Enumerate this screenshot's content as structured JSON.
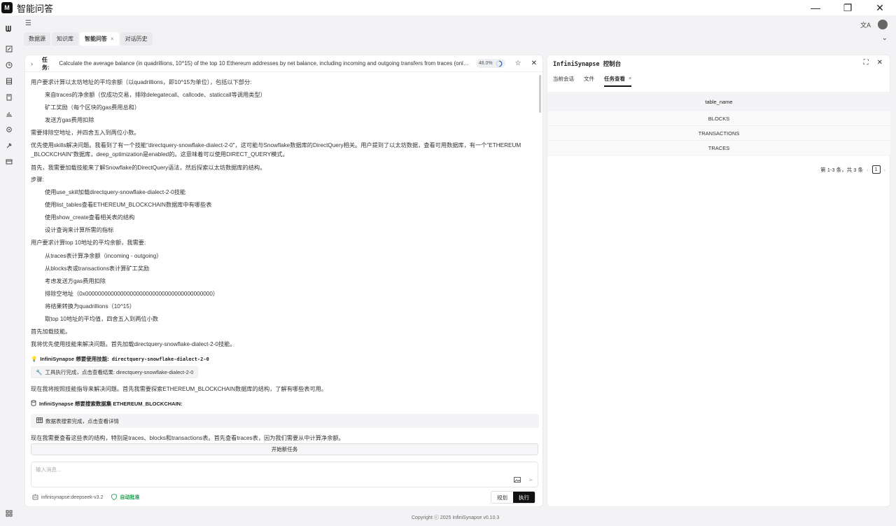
{
  "app": {
    "title": "智能问答",
    "logo_text": "M"
  },
  "window_controls": {
    "minimize": "—",
    "maximize": "❐",
    "close": "✕"
  },
  "rail": {
    "logo": "ᗯ"
  },
  "tabs": [
    {
      "label": "数据源"
    },
    {
      "label": "知识库"
    },
    {
      "label": "智能问答",
      "active": true,
      "closable": true
    },
    {
      "label": "对话历史"
    }
  ],
  "task": {
    "label": "任务:",
    "text": "Calculate the average balance (in quadrillions, 10^15) of the top 10 Ethereum addresses by net balance, including incoming and outgoing transfers from traces (only successful trans...",
    "progress": "48.0%"
  },
  "messages": [
    "用户要求计算以太坊地址的平均余额（以quadrillions，即10^15为单位），包括以下部分:",
    "来自traces的净余额（仅成功交易，排除delegatecall、callcode、staticcall等调用类型）",
    "矿工奖励（每个区块的gas费用总和）",
    "发送方gas费用扣除",
    "需要排除空地址，并四舍五入到两位小数。",
    "优先使用skills解决问题。我看到了有一个技能\"directquery-snowflake-dialect-2-0\"，这可能与Snowflake数据库的DirectQuery相关。用户提到了以太坊数据，查看可用数据库，有一个\"ETHEREUM",
    "_BLOCKCHAIN\"数据库，deep_optimization是enabled的。这意味着可以使用DIRECT_QUERY模式。",
    "首先，我需要加载技能来了解Snowflake的DirectQuery语法，然后探索以太坊数据库的结构。",
    "步骤:",
    "使用use_skill加载directquery-snowflake-dialect-2-0技能",
    "使用list_tables查看ETHEREUM_BLOCKCHAIN数据库中有哪些表",
    "使用show_create查看相关表的结构",
    "设计查询来计算所需的指标",
    "用户要求计算top 10地址的平均余额，我需要:",
    "从traces表计算净余额（incoming - outgoing）",
    "从blocks表或transactions表计算矿工奖励",
    "考虑发送方gas费用扣除",
    "排除空地址（0x0000000000000000000000000000000000000000）",
    "将结果转换为quadrillions（10^15）",
    "取top 10地址的平均值，四舍五入到两位小数",
    "首先加载技能。",
    "我将优先使用技能来解决问题。首先加载directquery-snowflake-dialect-2-0技能。"
  ],
  "skill_use": {
    "prefix": "InfiniSynapse 想要使用技能:",
    "skill": "directquery-snowflake-dialect-2-0"
  },
  "tool_done": "工具执行完成，点击查看结果: directquery-snowflake-dialect-2-0",
  "after_tool": "现在我将按照技能指导来解决问题。首先我需要探索ETHEREUM_BLOCKCHAIN数据库的结构，了解有哪些表可用。",
  "db_search": "InfiniSynapse 想要搜索数据集 ETHEREUM_BLOCKCHAIN:",
  "db_done": "数据表搜索完成，点击查看详情",
  "after_db": "现在我需要查看这些表的结构，特别是traces、blocks和transactions表。首先查看traces表，因为我们需要从中计算净余额。",
  "new_task": "开始新任务",
  "input": {
    "placeholder": "输入消息..."
  },
  "model": "infinisynapse:deepseek-v3.2",
  "auto_approve": "自动批准",
  "modes": {
    "plan": "规划",
    "execute": "执行"
  },
  "console": {
    "title": "InfiniSynapse 控制台",
    "tabs": [
      {
        "label": "当前会话"
      },
      {
        "label": "文件"
      },
      {
        "label": "任务查看",
        "active": true
      }
    ],
    "table_header": "table_name",
    "rows": [
      "BLOCKS",
      "TRANSACTIONS",
      "TRACES"
    ],
    "pager_text": "第 1-3 条，共 3 条",
    "page": "1"
  },
  "copyright": "Copyright ⓒ 2025 InfiniSynapse v0.10.3",
  "colors": {
    "accent": "#111111",
    "success": "#1a9a4a"
  }
}
